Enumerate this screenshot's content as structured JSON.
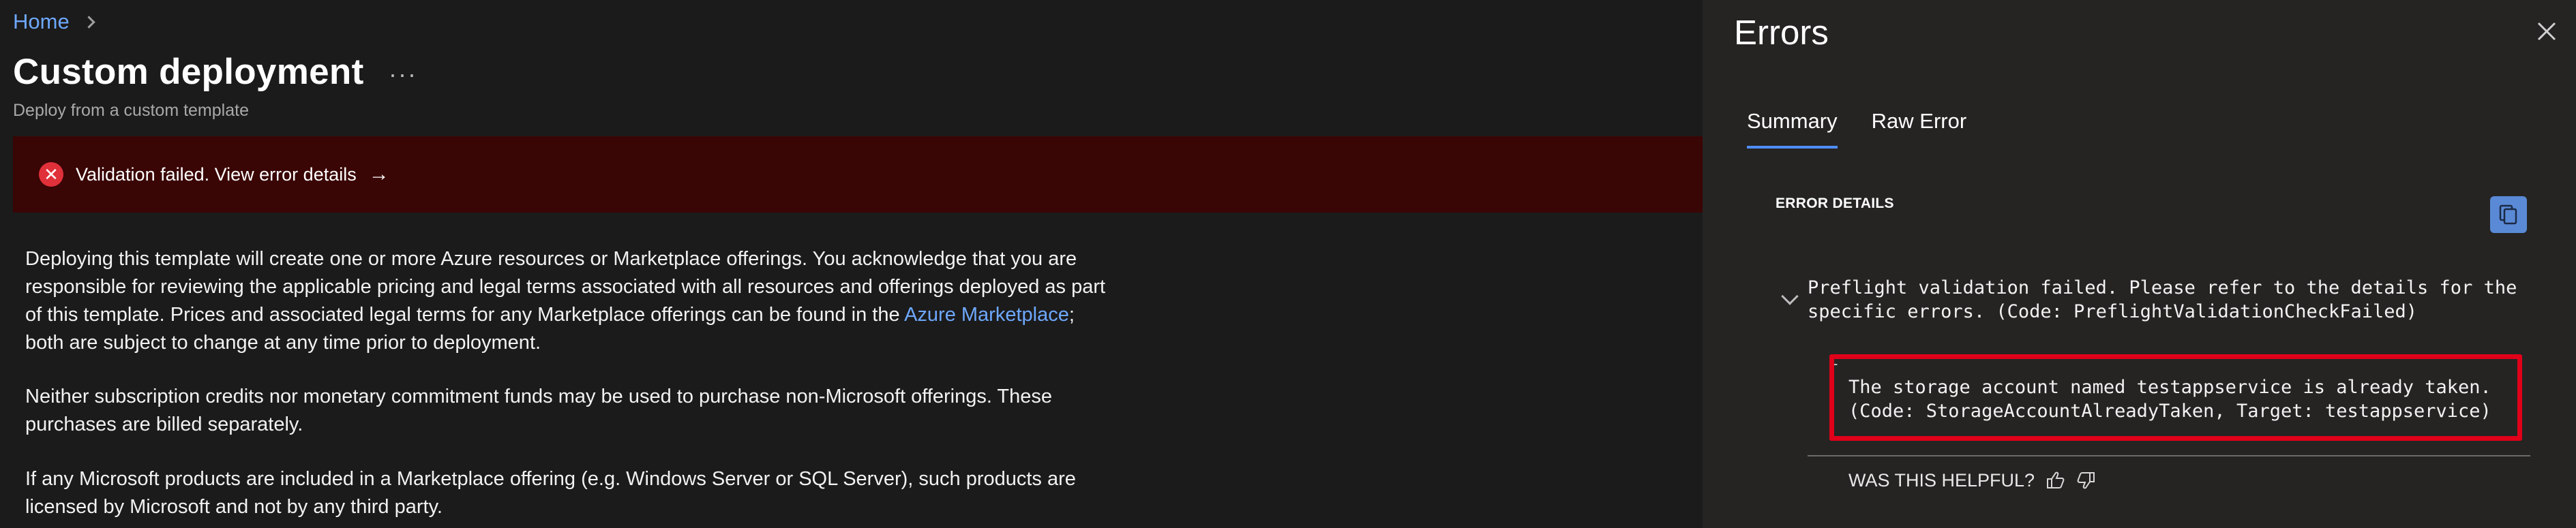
{
  "breadcrumb": {
    "home": "Home"
  },
  "page": {
    "title": "Custom deployment",
    "more": "···",
    "subtitle": "Deploy from a custom template"
  },
  "banner": {
    "text": "Validation failed. View error details",
    "arrow": "→",
    "status_color": "#e0303a"
  },
  "terms": {
    "p1_before_link": "Deploying this template will create one or more Azure resources or Marketplace offerings.  You acknowledge that you are responsible for reviewing the applicable pricing and legal terms associated with all resources and offerings deployed as part of this template.  Prices and associated legal terms for any Marketplace offerings can be found in the ",
    "p1_link": "Azure Marketplace",
    "p1_after_link": "; both are subject to change at any time prior to deployment.",
    "p2": "Neither subscription credits nor monetary commitment funds may be used to purchase non-Microsoft offerings. These purchases are billed separately.",
    "p3": "If any Microsoft products are included in a Marketplace offering (e.g. Windows Server or SQL Server), such products are licensed by Microsoft and not by any third party."
  },
  "errors_panel": {
    "title": "Errors",
    "tabs": [
      {
        "label": "Summary",
        "active": true
      },
      {
        "label": "Raw Error",
        "active": false
      }
    ],
    "details_label": "ERROR DETAILS",
    "preflight_message": "Preflight validation failed. Please refer to the details for the specific errors. (Code: PreflightValidationCheckFailed)",
    "storage_message": "The storage account named testappservice is already taken. (Code: StorageAccountAlreadyTaken, Target: testappservice)",
    "helpful_prompt": "WAS THIS HELPFUL?",
    "highlight_color": "#e0001a",
    "accent_color": "#4f8ef7"
  }
}
